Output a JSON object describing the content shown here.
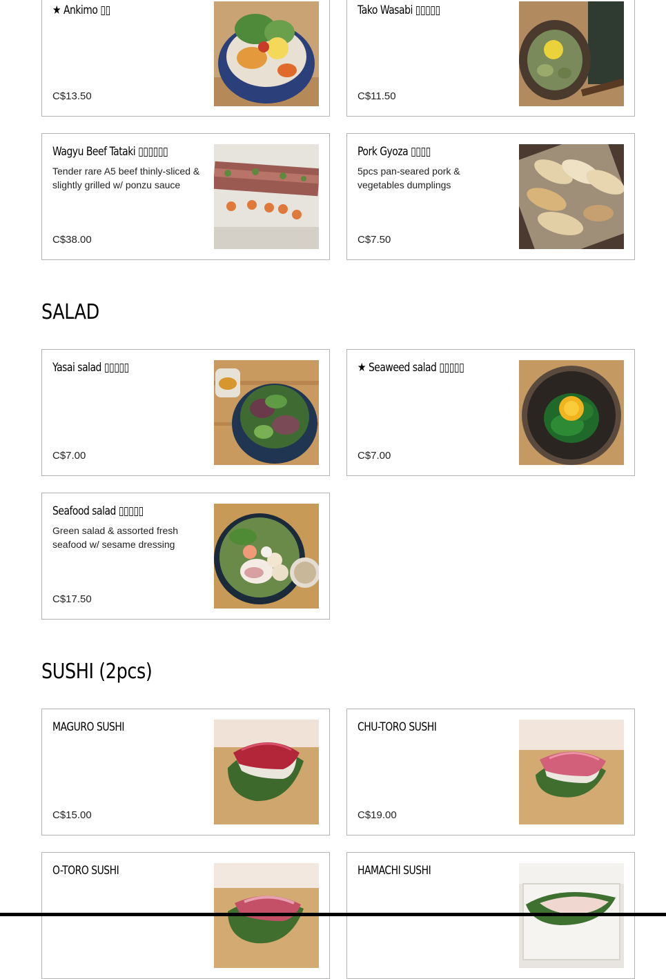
{
  "sections": {
    "salad": {
      "title": "SALAD"
    },
    "sushi": {
      "title": "SUSHI (2pcs)"
    }
  },
  "items": {
    "ankimo": {
      "name": "★ Ankimo ▯▯",
      "desc": "",
      "price": "C$13.50"
    },
    "tako_wasabi": {
      "name": "Tako Wasabi ▯▯▯▯▯",
      "desc": "",
      "price": "C$11.50"
    },
    "wagyu": {
      "name": "Wagyu Beef Tataki ▯▯▯▯▯▯",
      "desc": "Tender rare A5 beef thinly-sliced & slightly grilled w/ ponzu sauce",
      "price": "C$38.00"
    },
    "gyoza": {
      "name": "Pork Gyoza ▯▯▯▯",
      "desc": "5pcs pan-seared pork & vegetables dumplings",
      "price": "C$7.50"
    },
    "yasai": {
      "name": "Yasai salad ▯▯▯▯▯",
      "desc": "",
      "price": "C$7.00"
    },
    "seaweed": {
      "name": "★ Seaweed salad ▯▯▯▯▯",
      "desc": "",
      "price": "C$7.00"
    },
    "seafood": {
      "name": "Seafood salad ▯▯▯▯▯",
      "desc": "Green salad & assorted fresh seafood w/ sesame dressing",
      "price": "C$17.50"
    },
    "maguro": {
      "name": "MAGURO SUSHI",
      "desc": "",
      "price": "C$15.00"
    },
    "chutoro": {
      "name": "CHU-TORO SUSHI",
      "desc": "",
      "price": "C$19.00"
    },
    "otoro": {
      "name": "O-TORO SUSHI",
      "desc": "",
      "price": ""
    },
    "hamachi": {
      "name": "HAMACHI SUSHI",
      "desc": "",
      "price": ""
    }
  },
  "colors": {
    "card_border": "#b3b3b3",
    "text": "#000000",
    "price_text": "#222222"
  }
}
